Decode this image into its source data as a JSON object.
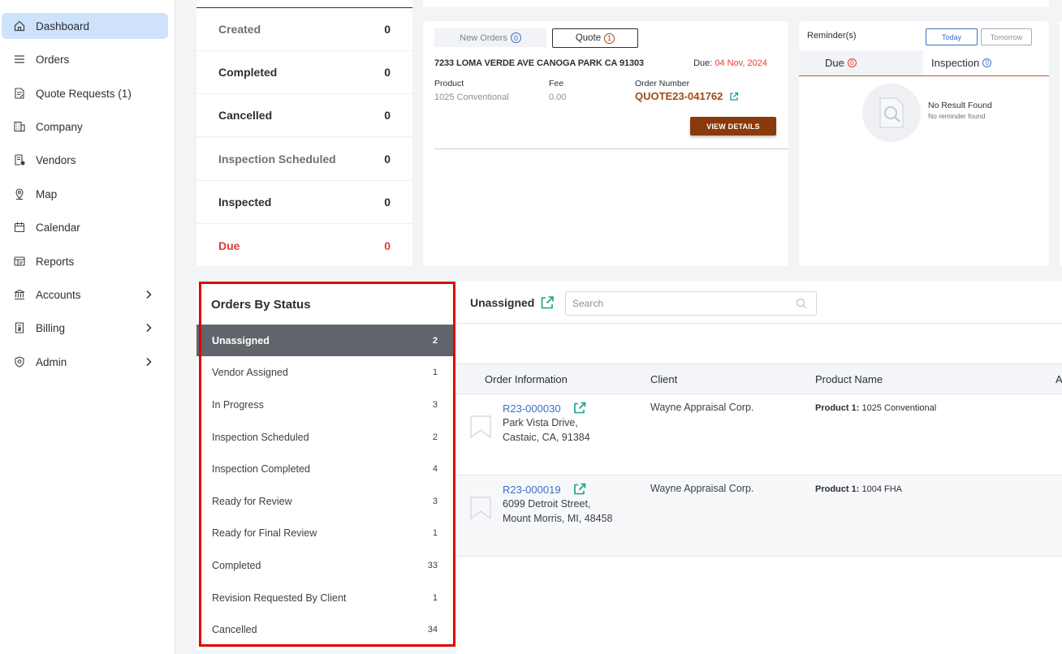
{
  "sidebar": {
    "items": [
      {
        "label": "Dashboard",
        "icon": "home-icon",
        "active": true
      },
      {
        "label": "Orders",
        "icon": "list-icon"
      },
      {
        "label": "Quote Requests (1)",
        "icon": "document-edit-icon"
      },
      {
        "label": "Company",
        "icon": "building-icon"
      },
      {
        "label": "Vendors",
        "icon": "vendor-document-icon"
      },
      {
        "label": "Map",
        "icon": "map-pin-icon"
      },
      {
        "label": "Calendar",
        "icon": "calendar-icon"
      },
      {
        "label": "Reports",
        "icon": "reports-icon"
      },
      {
        "label": "Accounts",
        "icon": "bank-icon",
        "chevron": true
      },
      {
        "label": "Billing",
        "icon": "billing-icon",
        "chevron": true
      },
      {
        "label": "Admin",
        "icon": "admin-badge-icon",
        "chevron": true
      }
    ]
  },
  "counts": [
    {
      "label": "Created",
      "value": "0"
    },
    {
      "label": "Completed",
      "value": "0"
    },
    {
      "label": "Cancelled",
      "value": "0"
    },
    {
      "label": "Inspection Scheduled",
      "value": "0"
    },
    {
      "label": "Inspected",
      "value": "0"
    },
    {
      "label": "Due",
      "value": "0"
    }
  ],
  "quote_card": {
    "tab_new_label": "New Orders",
    "tab_new_count": "0",
    "tab_quote_label": "Quote",
    "tab_quote_count": "1",
    "address": "7233 LOMA VERDE AVE CANOGA PARK CA 91303",
    "due_label": "Due:",
    "due_date": "04 Nov, 2024",
    "product_label": "Product",
    "product_value": "1025 Conventional",
    "fee_label": "Fee",
    "fee_value": "0.00",
    "order_number_label": "Order Number",
    "order_number": "QUOTE23-041762",
    "view_button": "VIEW DETAILS"
  },
  "reminders": {
    "title": "Reminder(s)",
    "today": "Today",
    "tomorrow": "Tomorrow",
    "tab_due": "Due",
    "tab_due_count": "0",
    "tab_inspection": "Inspection",
    "tab_inspection_count": "0",
    "no_result_title": "No Result Found",
    "no_result_sub": "No reminder found"
  },
  "orders_by_status": {
    "title": "Orders By Status",
    "items": [
      {
        "label": "Unassigned",
        "count": "2",
        "selected": true
      },
      {
        "label": "Vendor Assigned",
        "count": "1"
      },
      {
        "label": "In Progress",
        "count": "3"
      },
      {
        "label": "Inspection Scheduled",
        "count": "2"
      },
      {
        "label": "Inspection Completed",
        "count": "4"
      },
      {
        "label": "Ready for Review",
        "count": "3"
      },
      {
        "label": "Ready for Final Review",
        "count": "1"
      },
      {
        "label": "Completed",
        "count": "33"
      },
      {
        "label": "Revision Requested By Client",
        "count": "1"
      },
      {
        "label": "Cancelled",
        "count": "34"
      }
    ]
  },
  "orders_list": {
    "title": "Unassigned",
    "search_placeholder": "Search",
    "columns": [
      "Order Information",
      "Client",
      "Product Name",
      "A"
    ],
    "rows": [
      {
        "order_number": "R23-000030",
        "address_line1": "Park Vista Drive,",
        "address_line2": "Castaic, CA, 91384",
        "client": "Wayne Appraisal Corp.",
        "product_label": "Product 1:",
        "product": "1025 Conventional"
      },
      {
        "order_number": "R23-000019",
        "address_line1": "6099 Detroit Street,",
        "address_line2": "Mount Morris, MI, 48458",
        "client": "Wayne Appraisal Corp.",
        "product_label": "Product 1:",
        "product": "1004 FHA"
      }
    ]
  },
  "colors": {
    "accent_blue": "#3a6fc4",
    "brand_brown": "#8a3a0a",
    "alert_red": "#e53935",
    "highlight_border": "#e10000",
    "link_green": "#1aa08a"
  }
}
